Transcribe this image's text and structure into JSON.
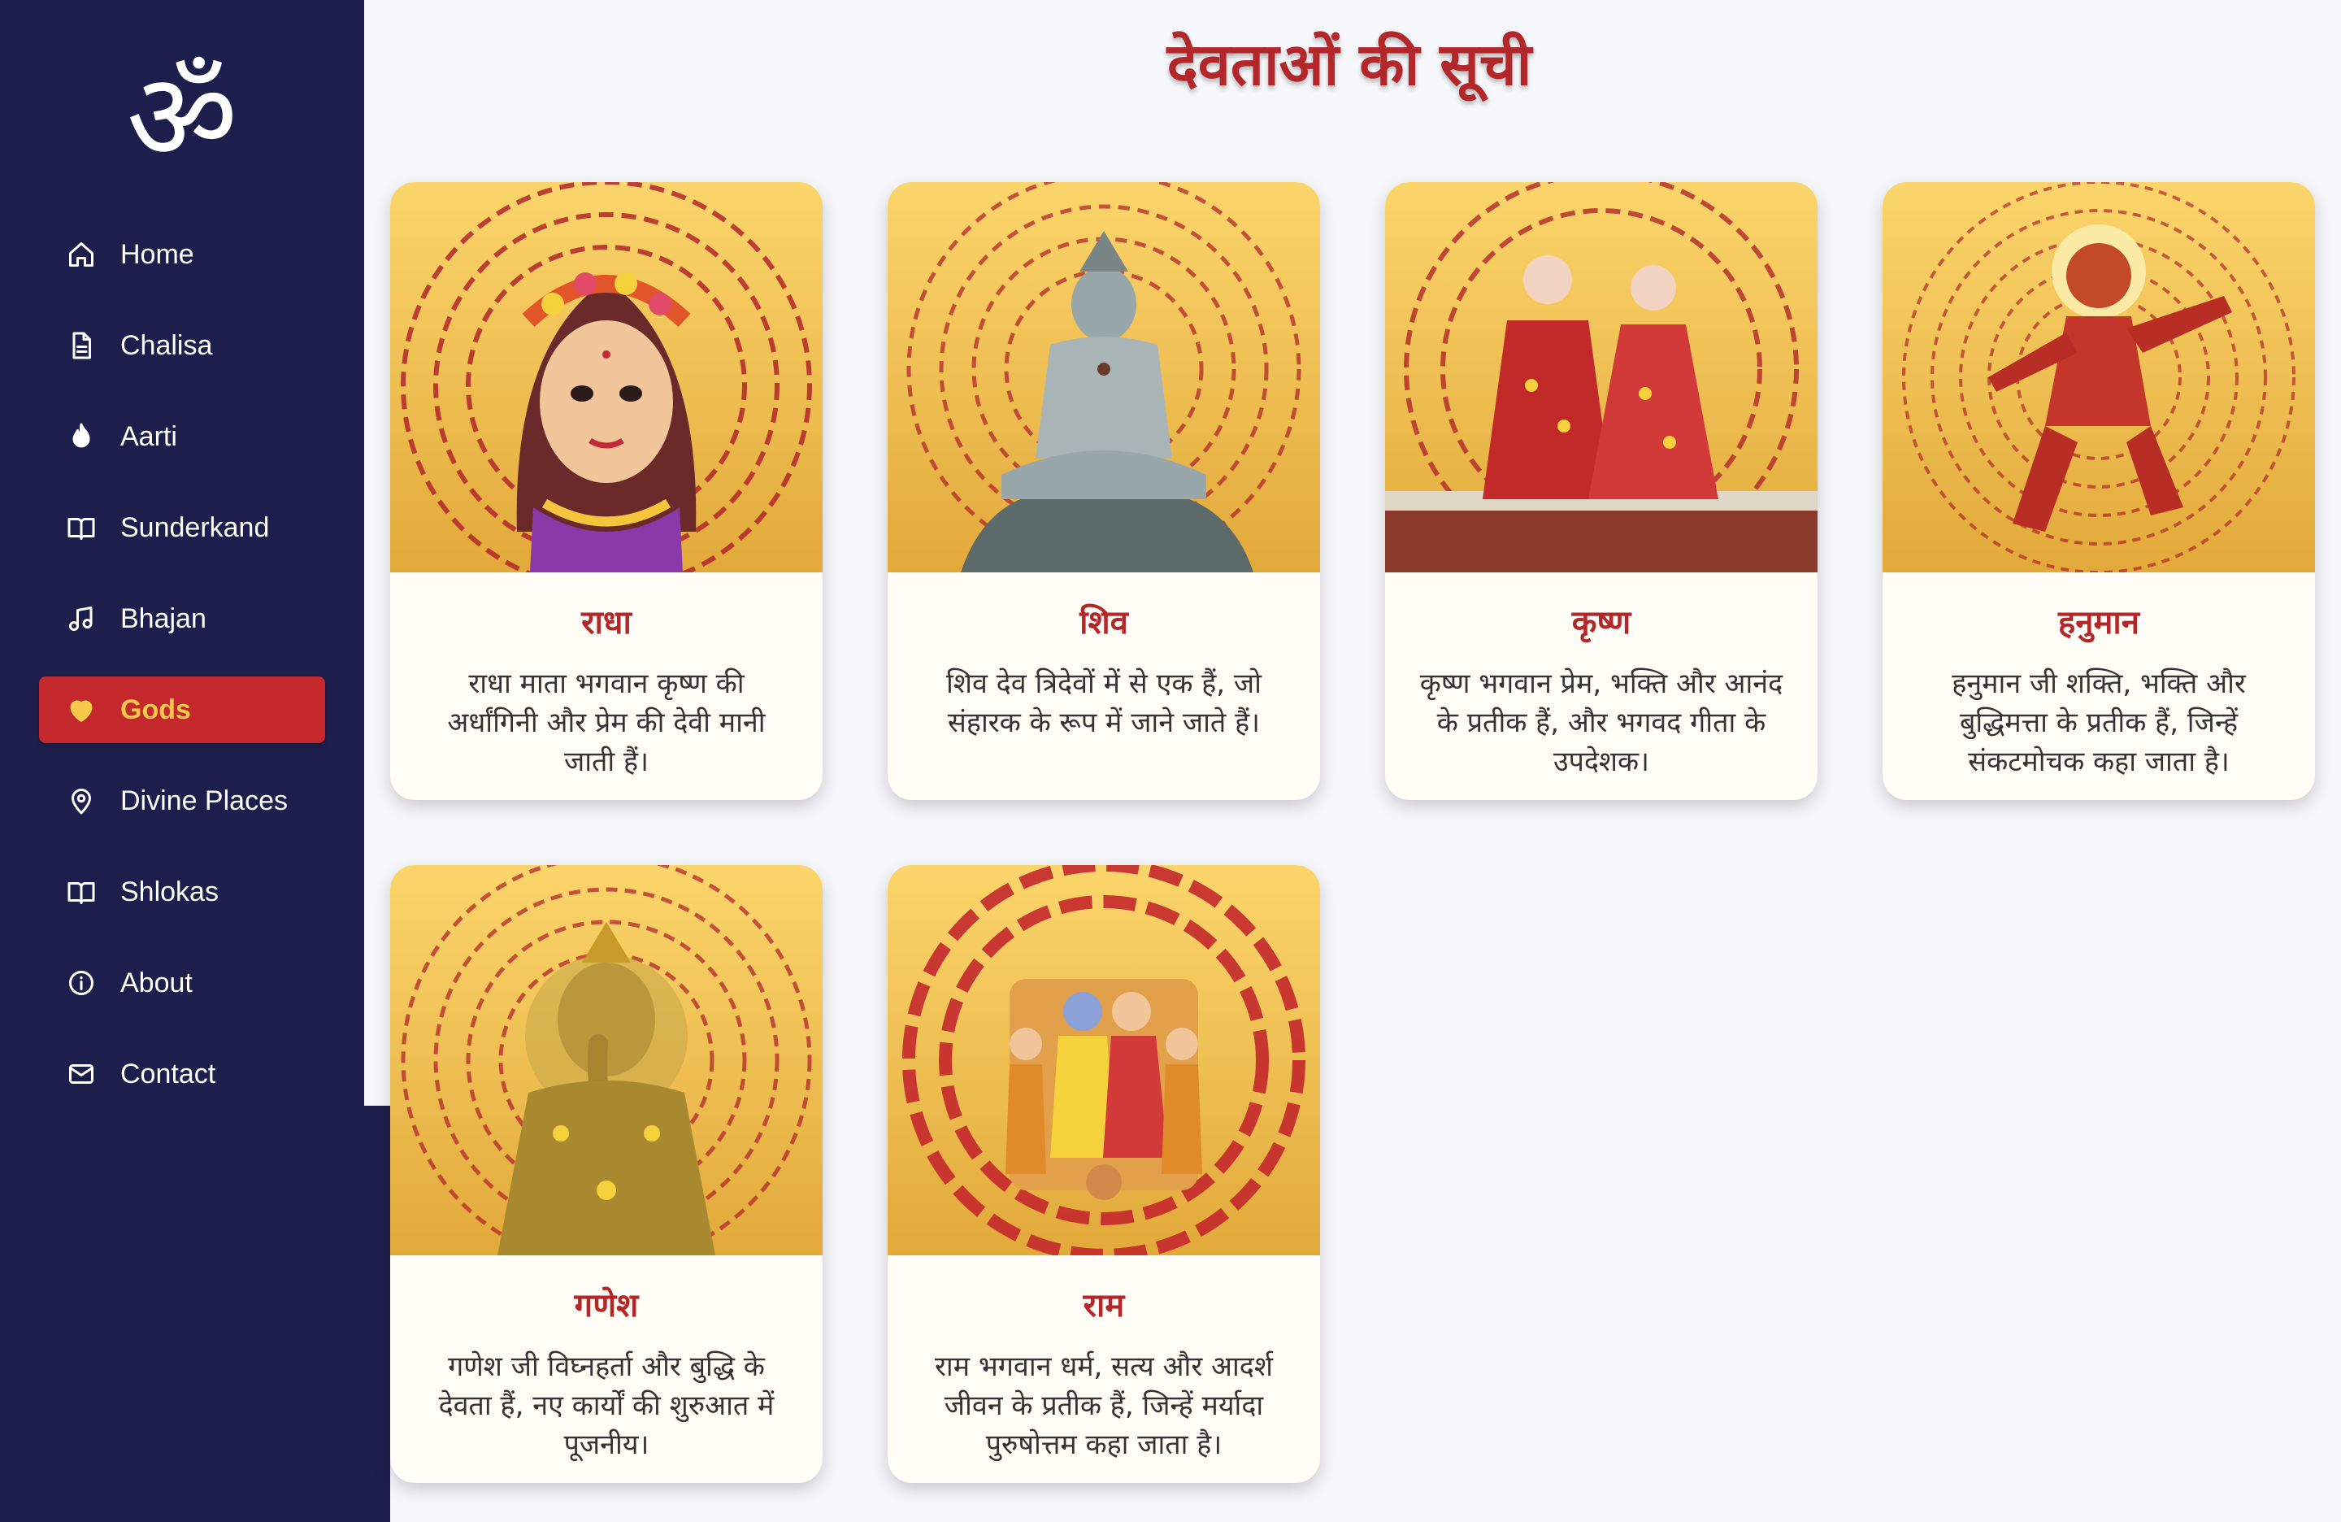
{
  "sidebar": {
    "logo": "ॐ",
    "items": [
      {
        "label": "Home",
        "icon": "home-icon"
      },
      {
        "label": "Chalisa",
        "icon": "document-icon"
      },
      {
        "label": "Aarti",
        "icon": "flame-icon"
      },
      {
        "label": "Sunderkand",
        "icon": "book-open-icon"
      },
      {
        "label": "Bhajan",
        "icon": "music-note-icon"
      },
      {
        "label": "Gods",
        "icon": "heart-icon",
        "active": true
      },
      {
        "label": "Divine Places",
        "icon": "map-pin-icon"
      },
      {
        "label": "Shlokas",
        "icon": "book-open-icon"
      },
      {
        "label": "About",
        "icon": "info-icon"
      },
      {
        "label": "Contact",
        "icon": "mail-icon"
      }
    ]
  },
  "main": {
    "title": "देवताओं की सूची",
    "cards": [
      {
        "name": "राधा",
        "description": "राधा माता भगवान कृष्ण की अर्धांगिनी और प्रेम की देवी मानी जाती हैं।",
        "image": "radha-image"
      },
      {
        "name": "शिव",
        "description": "शिव देव त्रिदेवों में से एक हैं, जो संहारक के रूप में जाने जाते हैं।",
        "image": "shiva-image"
      },
      {
        "name": "कृष्ण",
        "description": "कृष्ण भगवान प्रेम, भक्ति और आनंद के प्रतीक हैं, और भगवद गीता के उपदेशक।",
        "image": "krishna-image"
      },
      {
        "name": "हनुमान",
        "description": "हनुमान जी शक्ति, भक्ति और बुद्धिमत्ता के प्रतीक हैं, जिन्हें संकटमोचक कहा जाता है।",
        "image": "hanuman-image"
      },
      {
        "name": "गणेश",
        "description": "गणेश जी विघ्नहर्ता और बुद्धि के देवता हैं, नए कार्यों की शुरुआत में पूजनीय।",
        "image": "ganesh-image"
      },
      {
        "name": "राम",
        "description": "राम भगवान धर्म, सत्य और आदर्श जीवन के प्रतीक हैं, जिन्हें मर्यादा पुरुषोत्तम कहा जाता है।",
        "image": "ram-image"
      }
    ]
  },
  "colors": {
    "sidebar_bg": "#1e1e4d",
    "accent_red": "#c4282c",
    "accent_gold": "#f6c94a",
    "title_red": "#b3262a",
    "card_bg": "#fffdf6"
  }
}
